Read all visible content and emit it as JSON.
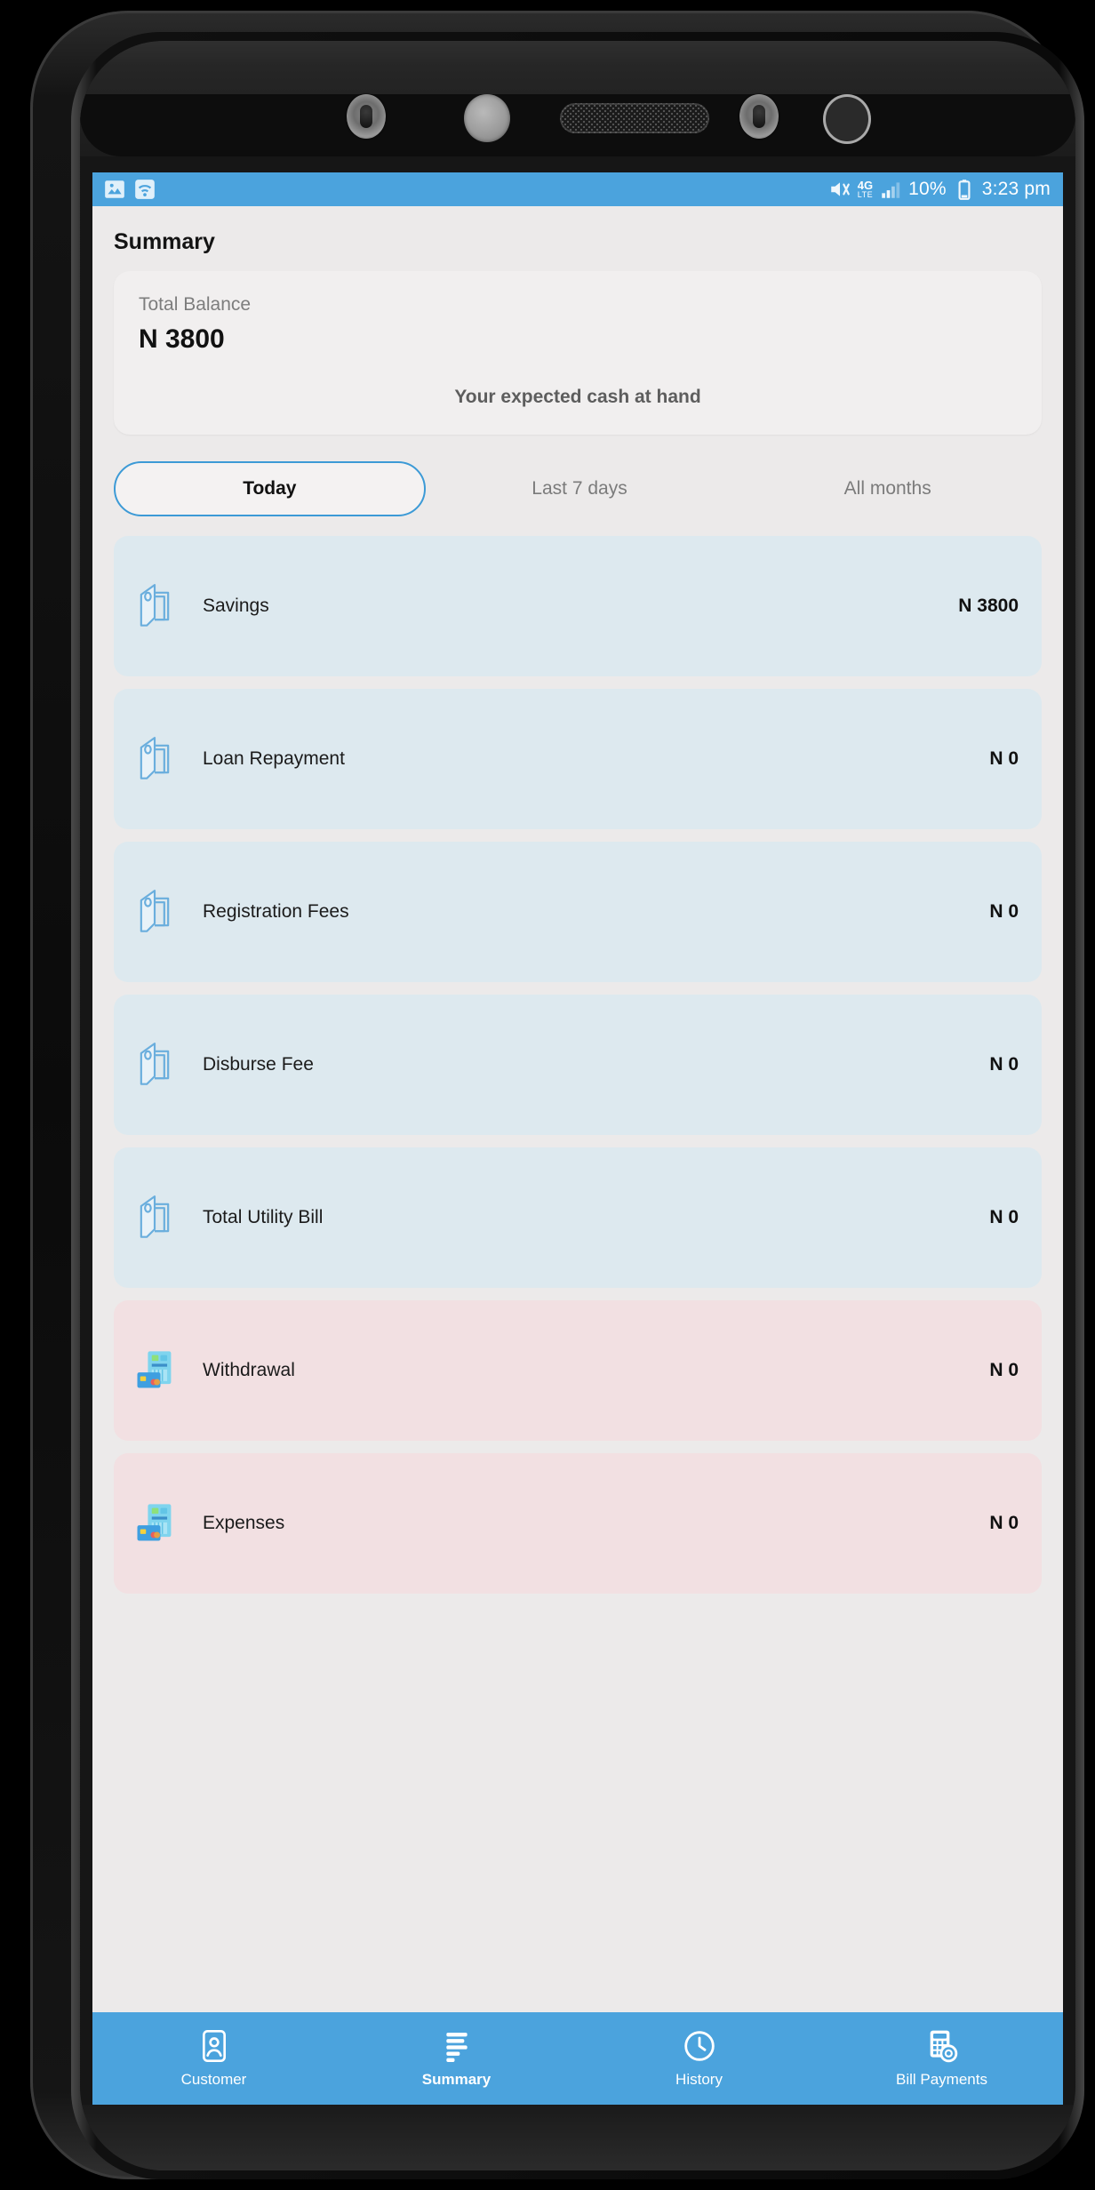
{
  "status_bar": {
    "left_icons": [
      "screenshot-icon",
      "wifi-icon"
    ],
    "mute_icon": "mute-icon",
    "network_label": "4G",
    "network_sub": "LTE",
    "signal_icon": "signal-bars-icon",
    "battery_percent": "10%",
    "battery_icon": "battery-low-icon",
    "time": "3:23 pm"
  },
  "header": {
    "title": "Summary"
  },
  "balance_card": {
    "label": "Total Balance",
    "value": "N 3800",
    "subtitle": "Your expected cash at hand"
  },
  "tabs": [
    {
      "label": "Today",
      "active": true
    },
    {
      "label": "Last 7 days",
      "active": false
    },
    {
      "label": "All months",
      "active": false
    }
  ],
  "rows": [
    {
      "label": "Savings",
      "value": "N 3800",
      "kind": "credit",
      "icon": "document-receipt-icon"
    },
    {
      "label": "Loan Repayment",
      "value": "N 0",
      "kind": "credit",
      "icon": "document-receipt-icon"
    },
    {
      "label": "Registration Fees",
      "value": "N 0",
      "kind": "credit",
      "icon": "document-receipt-icon"
    },
    {
      "label": "Disburse Fee",
      "value": "N 0",
      "kind": "credit",
      "icon": "document-receipt-icon"
    },
    {
      "label": "Total Utility Bill",
      "value": "N 0",
      "kind": "credit",
      "icon": "document-receipt-icon"
    },
    {
      "label": "Withdrawal",
      "value": "N 0",
      "kind": "debit",
      "icon": "atm-card-icon"
    },
    {
      "label": "Expenses",
      "value": "N 0",
      "kind": "debit",
      "icon": "atm-card-icon"
    }
  ],
  "bottom_nav": [
    {
      "label": "Customer",
      "icon": "contact-card-icon",
      "active": false
    },
    {
      "label": "Summary",
      "icon": "list-bars-icon",
      "active": true
    },
    {
      "label": "History",
      "icon": "clock-icon",
      "active": false
    },
    {
      "label": "Bill Payments",
      "icon": "calculator-coin-icon",
      "active": false
    }
  ],
  "colors": {
    "accent_blue": "#4ba3dd",
    "credit_row": "#dde9ef",
    "debit_row": "#f2e0e2",
    "page_bg": "#eceaea"
  }
}
